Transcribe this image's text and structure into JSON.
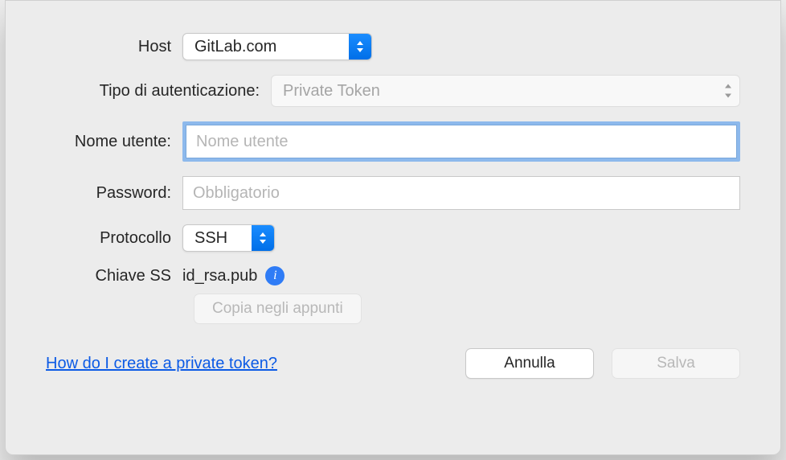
{
  "labels": {
    "host": "Host",
    "auth_type": "Tipo di autenticazione:",
    "username": "Nome utente:",
    "password": "Password:",
    "protocol": "Protocollo",
    "ssh_key": "Chiave SS"
  },
  "fields": {
    "host": {
      "selected": "GitLab.com"
    },
    "auth_type": {
      "selected": "Private Token"
    },
    "username": {
      "value": "",
      "placeholder": "Nome utente"
    },
    "password": {
      "value": "",
      "placeholder": "Obbligatorio"
    },
    "protocol": {
      "selected": "SSH"
    },
    "ssh_key": {
      "value": "id_rsa.pub"
    }
  },
  "buttons": {
    "copy": "Copia negli appunti",
    "cancel": "Annulla",
    "save": "Salva"
  },
  "help_link": "How do I create a private token?",
  "info_glyph": "i"
}
